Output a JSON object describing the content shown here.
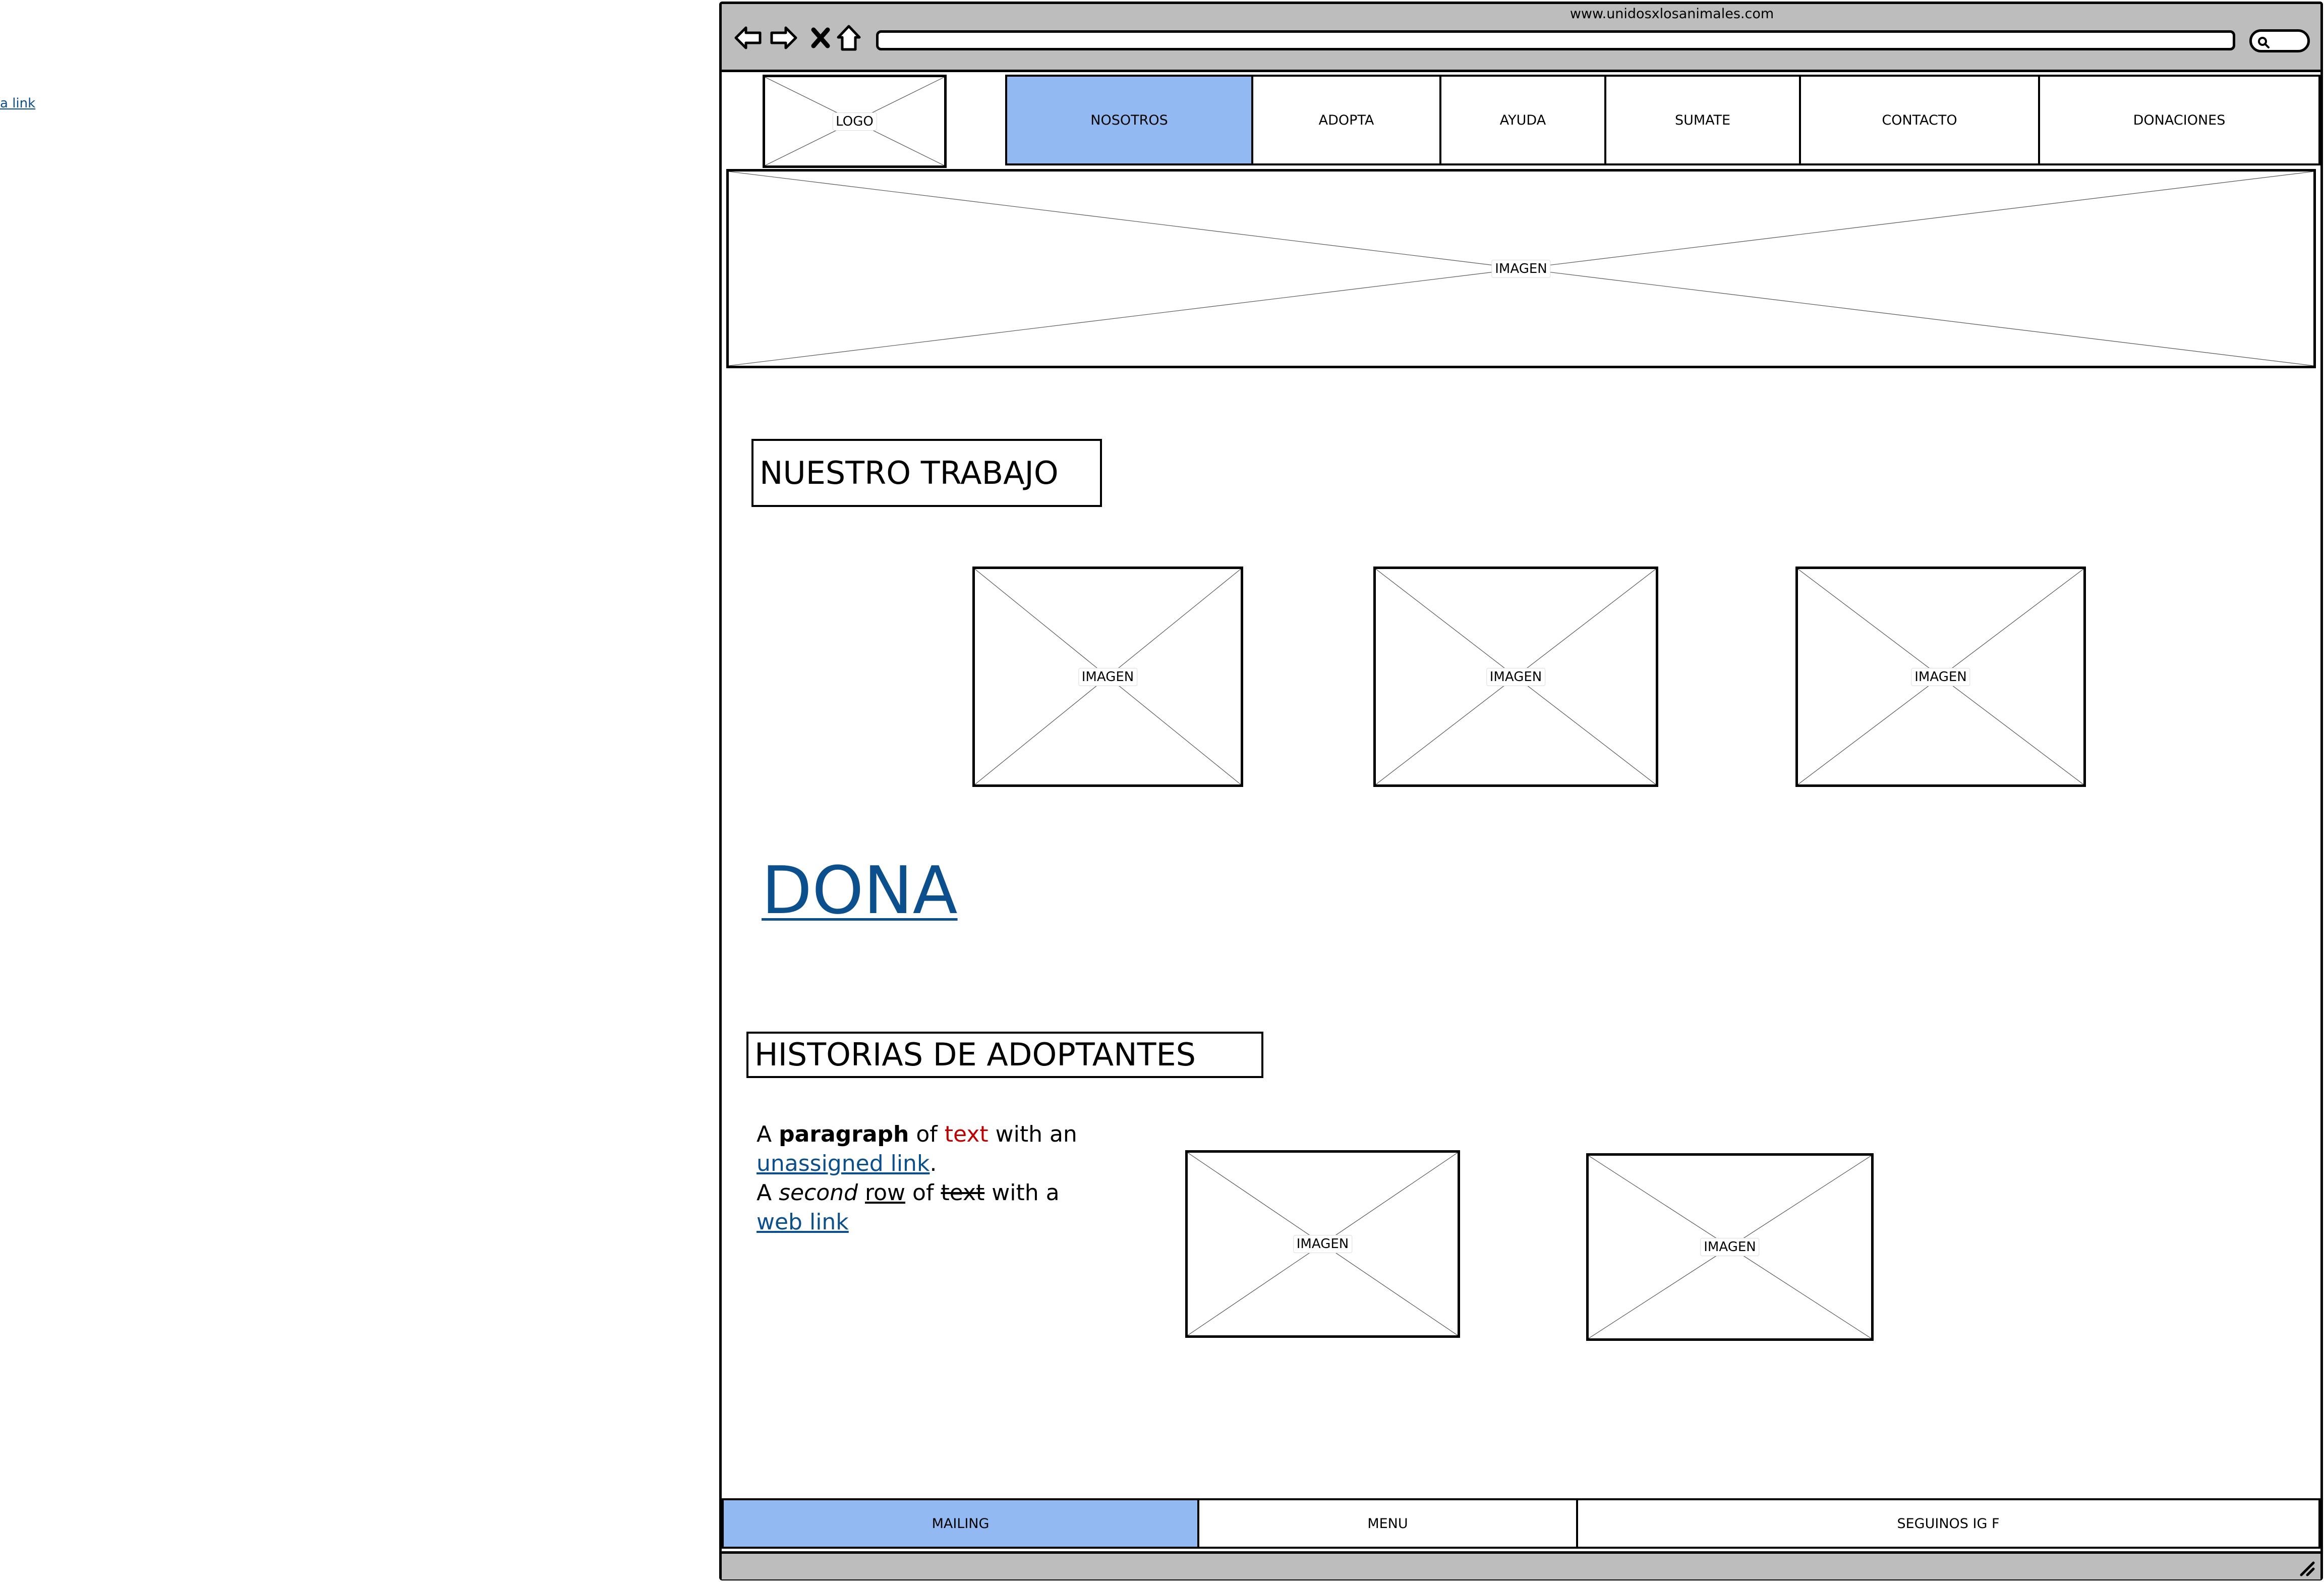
{
  "stray_link": "a link",
  "browser": {
    "url": "www.unidosxlosanimales.com",
    "icons": [
      "back-arrow-icon",
      "forward-arrow-icon",
      "close-icon",
      "home-icon",
      "search-icon",
      "resize-handle-icon"
    ]
  },
  "header": {
    "logo": "LOGO",
    "nav": [
      {
        "label": "NOSOTROS",
        "active": true
      },
      {
        "label": "ADOPTA",
        "active": false
      },
      {
        "label": "AYUDA",
        "active": false
      },
      {
        "label": "SUMATE",
        "active": false
      },
      {
        "label": "CONTACTO",
        "active": false
      },
      {
        "label": "DONACIONES",
        "active": false
      }
    ]
  },
  "hero": {
    "label": "IMAGEN"
  },
  "trabajo": {
    "heading": "NUESTRO TRABAJO",
    "images": [
      "IMAGEN",
      "IMAGEN",
      "IMAGEN"
    ]
  },
  "dona": {
    "label": "DONA"
  },
  "historias": {
    "heading": "HISTORIAS DE ADOPTANTES",
    "paragraph": {
      "p1": "A ",
      "p2": "paragraph",
      "p3": " of ",
      "p4": "text",
      "p5": " with an ",
      "p6": "unassigned link",
      "p7": ".",
      "p8": "A ",
      "p9": "second",
      "p10": " ",
      "p11": "row",
      "p12": " of ",
      "p13": "text",
      "p14": " with a ",
      "p15": "web link"
    },
    "images": [
      "IMAGEN",
      "IMAGEN"
    ]
  },
  "footer": {
    "items": [
      {
        "label": "MAILING",
        "active": true
      },
      {
        "label": "MENU",
        "active": false
      },
      {
        "label": "SEGUINOS IG F",
        "active": false
      }
    ]
  },
  "colors": {
    "active_tab": "#92b9f2",
    "link": "#0b4f8c",
    "chrome": "#bdbdbd",
    "red_text": "#c00000"
  }
}
